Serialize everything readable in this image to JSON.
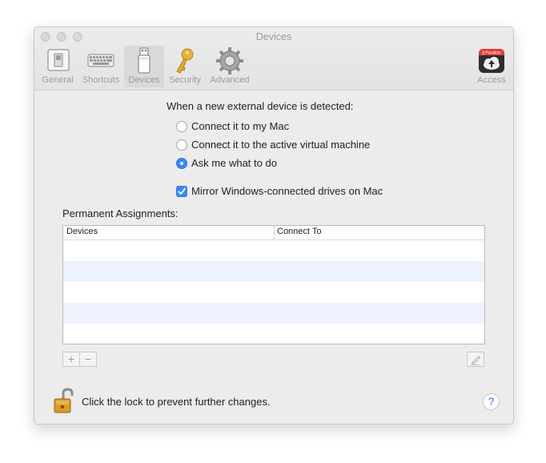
{
  "window": {
    "title": "Devices"
  },
  "toolbar": {
    "items": [
      {
        "label": "General",
        "icon": "general-switch-icon"
      },
      {
        "label": "Shortcuts",
        "icon": "keyboard-icon"
      },
      {
        "label": "Devices",
        "icon": "usb-drive-icon",
        "selected": true
      },
      {
        "label": "Security",
        "icon": "key-icon"
      },
      {
        "label": "Advanced",
        "icon": "gear-icon"
      }
    ],
    "access": {
      "label": "Access",
      "icon": "parallels-access-icon",
      "badge": "|| Parallels"
    }
  },
  "detection": {
    "prompt": "When a new external device is detected:",
    "options": [
      {
        "label": "Connect it to my Mac",
        "checked": false
      },
      {
        "label": "Connect it to the active virtual machine",
        "checked": false
      },
      {
        "label": "Ask me what to do",
        "checked": true
      }
    ],
    "mirror": {
      "label": "Mirror Windows-connected drives on Mac",
      "checked": true
    }
  },
  "assignments": {
    "title": "Permanent Assignments:",
    "columns": [
      "Devices",
      "Connect To"
    ],
    "rows": []
  },
  "table_buttons": {
    "add": "+",
    "remove": "−"
  },
  "footer": {
    "lock_text": "Click the lock to prevent further changes.",
    "help": "?"
  },
  "colors": {
    "accent": "#3b88f7",
    "row_alt": "#edf2fc",
    "window_bg": "#ececec"
  }
}
